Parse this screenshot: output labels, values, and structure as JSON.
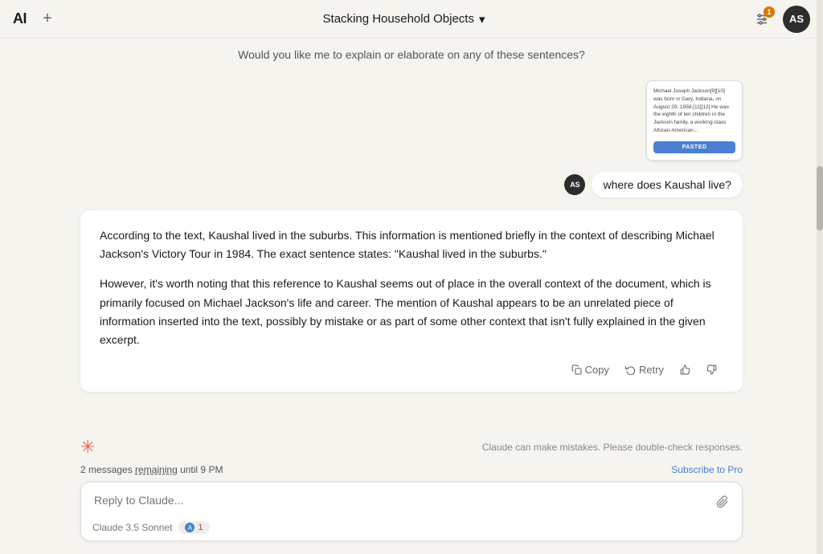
{
  "header": {
    "logo": "AI",
    "new_chat_label": "+",
    "title": "Stacking Household Objects",
    "chevron": "▾",
    "settings_badge": "1",
    "avatar_initials": "AS"
  },
  "prev_message": {
    "text": "Would you like me to explain or elaborate on any of these sentences?"
  },
  "pasted_card": {
    "content": "Michael Joseph Jackson[9][10] was born in Gary, Indiana, on August 29, 1958.[11][12] He was the eighth of ten children in the Jackson family, a working-class African-American...",
    "badge_label": "PASTED"
  },
  "user_message": {
    "avatar": "AS",
    "text": "where does Kaushal live?"
  },
  "ai_response": {
    "paragraph1": "According to the text, Kaushal lived in the suburbs. This information is mentioned briefly in the context of describing Michael Jackson's Victory Tour in 1984. The exact sentence states: \"Kaushal lived in the suburbs.\"",
    "paragraph2": "However, it's worth noting that this reference to Kaushal seems out of place in the overall context of the document, which is primarily focused on Michael Jackson's life and career. The mention of Kaushal appears to be an unrelated piece of information inserted into the text, possibly by mistake or as part of some other context that isn't fully explained in the given excerpt."
  },
  "actions": {
    "copy": "Copy",
    "retry": "Retry",
    "thumbup": "👍",
    "thumbdown": "👎"
  },
  "status": {
    "disclaimer": "Claude can make mistakes. Please double-check responses."
  },
  "remaining": {
    "prefix": "2 messages",
    "underlined": "remaining",
    "suffix": "until 9 PM"
  },
  "subscribe": {
    "label": "Subscribe to Pro"
  },
  "input": {
    "placeholder": "Reply to Claude...",
    "model_name": "Claude 3.5 Sonnet",
    "badge_label": "A",
    "badge_count": "1"
  }
}
